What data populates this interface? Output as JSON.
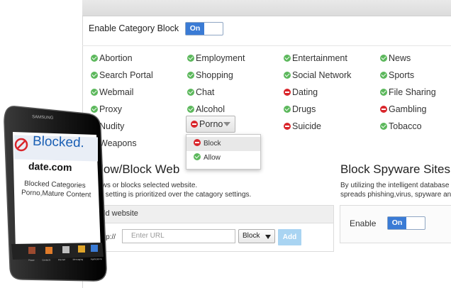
{
  "category_block": {
    "label": "Enable Category Block",
    "toggle": "On"
  },
  "categories": [
    {
      "name": "Abortion",
      "status": "allow"
    },
    {
      "name": "Employment",
      "status": "allow"
    },
    {
      "name": "Entertainment",
      "status": "allow"
    },
    {
      "name": "News",
      "status": "allow"
    },
    {
      "name": "Search Portal",
      "status": "allow"
    },
    {
      "name": "Shopping",
      "status": "allow"
    },
    {
      "name": "Social Network",
      "status": "allow"
    },
    {
      "name": "Sports",
      "status": "allow"
    },
    {
      "name": "Webmail",
      "status": "allow"
    },
    {
      "name": "Chat",
      "status": "allow"
    },
    {
      "name": "Dating",
      "status": "block"
    },
    {
      "name": "File Sharing",
      "status": "allow"
    },
    {
      "name": "Proxy",
      "status": "allow"
    },
    {
      "name": "Alcohol",
      "status": "allow"
    },
    {
      "name": "Drugs",
      "status": "allow"
    },
    {
      "name": "Gambling",
      "status": "block"
    },
    {
      "name": "Nudity",
      "status": "block"
    },
    {
      "name": "Porno",
      "status": "block"
    },
    {
      "name": "Suicide",
      "status": "block"
    },
    {
      "name": "Tobacco",
      "status": "allow"
    },
    {
      "name": "Weapons",
      "status": "allow"
    }
  ],
  "dropdown_menu": {
    "items": [
      {
        "label": "Block",
        "status": "block"
      },
      {
        "label": "Allow",
        "status": "allow"
      }
    ]
  },
  "allow_block": {
    "title": "Allow/Block Web",
    "desc1": "Allows or blocks selected website.",
    "desc2": "This setting is prioritized over the catagory settings.",
    "add_header": "Add website",
    "http_prefix": "http://",
    "url_placeholder": "Enter URL",
    "action_select": "Block",
    "add_button": "Add"
  },
  "spyware": {
    "title": "Block Spyware Sites",
    "desc1": "By utilizing the intelligent database",
    "desc2": "spreads phishing,virus, spyware an",
    "enable_label": "Enable",
    "toggle": "On"
  },
  "phone": {
    "brand": "SAMSUNG",
    "blocked_title": "Blocked.",
    "site": "date.com",
    "line1": "Blocked Categories",
    "line2": "Porno,Mature Content",
    "dock": [
      "Phone",
      "Contacts",
      "Internet",
      "Messaging",
      "Applications"
    ]
  },
  "colors": {
    "accent": "#3a7bd5",
    "allow": "#5cb85c",
    "block": "#d9262c",
    "add_button": "#a9d4f2"
  }
}
